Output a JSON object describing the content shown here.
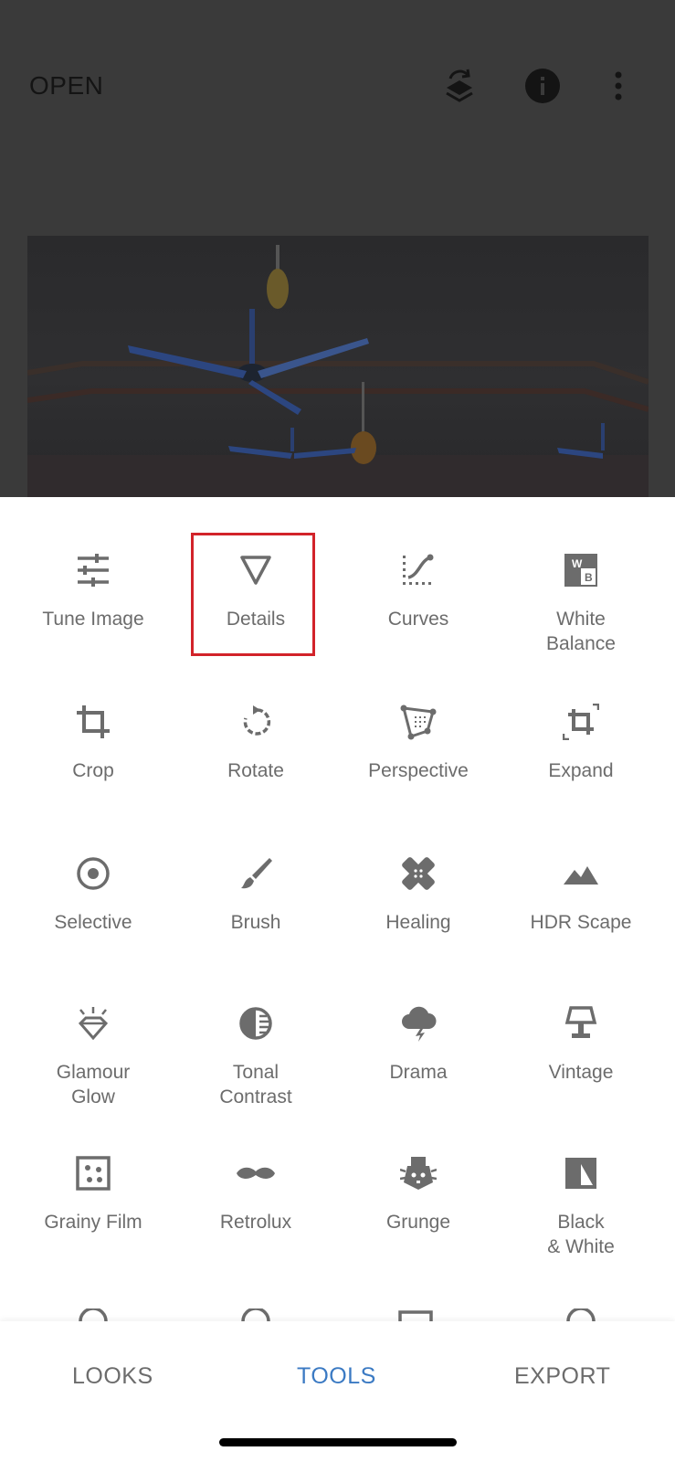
{
  "header": {
    "open_label": "OPEN",
    "icons": [
      "layers-undo-icon",
      "info-icon",
      "more-vertical-icon"
    ]
  },
  "tools": [
    {
      "label": "Tune Image",
      "icon": "tune-image-icon"
    },
    {
      "label": "Details",
      "icon": "details-icon"
    },
    {
      "label": "Curves",
      "icon": "curves-icon"
    },
    {
      "label": "White\nBalance",
      "icon": "white-balance-icon"
    },
    {
      "label": "Crop",
      "icon": "crop-icon"
    },
    {
      "label": "Rotate",
      "icon": "rotate-icon"
    },
    {
      "label": "Perspective",
      "icon": "perspective-icon"
    },
    {
      "label": "Expand",
      "icon": "expand-icon"
    },
    {
      "label": "Selective",
      "icon": "selective-icon"
    },
    {
      "label": "Brush",
      "icon": "brush-icon"
    },
    {
      "label": "Healing",
      "icon": "healing-icon"
    },
    {
      "label": "HDR Scape",
      "icon": "hdr-scape-icon"
    },
    {
      "label": "Glamour\nGlow",
      "icon": "glamour-glow-icon"
    },
    {
      "label": "Tonal\nContrast",
      "icon": "tonal-contrast-icon"
    },
    {
      "label": "Drama",
      "icon": "drama-icon"
    },
    {
      "label": "Vintage",
      "icon": "vintage-icon"
    },
    {
      "label": "Grainy Film",
      "icon": "grainy-film-icon"
    },
    {
      "label": "Retrolux",
      "icon": "retrolux-icon"
    },
    {
      "label": "Grunge",
      "icon": "grunge-icon"
    },
    {
      "label": "Black\n& White",
      "icon": "black-white-icon"
    }
  ],
  "bottom_tabs": [
    {
      "label": "LOOKS",
      "active": false
    },
    {
      "label": "TOOLS",
      "active": true
    },
    {
      "label": "EXPORT",
      "active": false
    }
  ],
  "colors": {
    "accent": "#3b7ac3",
    "highlight": "#d2232a",
    "icon": "#6c6c6c"
  }
}
